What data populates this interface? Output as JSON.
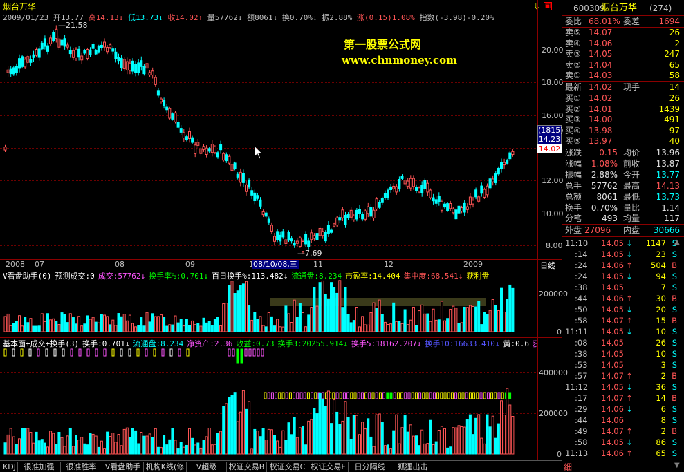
{
  "title": "烟台万华",
  "info_bar": {
    "date": "2009/01/23",
    "open": "开13.77",
    "high": "高14.13",
    "low": "低13.73",
    "close": "收14.02",
    "volume": "量57762",
    "amount": "额8061",
    "turnover": "换0.70%",
    "amplitude": "振2.88%",
    "change_label": "涨",
    "change": "(0.15)1.08%",
    "index": "指数(-3.98)-0.20%"
  },
  "watermark": {
    "line1": "第一股票公式网",
    "line2": "www.chnmoney.com"
  },
  "price_annotations": {
    "high_mark": "21.58",
    "low_mark": "7.69"
  },
  "price_axis": [
    "20.00",
    "18.00",
    "16.00",
    "14.00",
    "12.00",
    "10.00",
    "8.00"
  ],
  "crosshair_box": {
    "top": "(1815)",
    "value": "14.23"
  },
  "current_price_tag": "14.02",
  "date_axis": {
    "labels": [
      "2008",
      "07",
      "08",
      "09",
      "10",
      "11",
      "12",
      "2009"
    ],
    "cursor_date": "08/10/08,三",
    "period": "日线"
  },
  "ind1": {
    "header": [
      {
        "text": "V看盘助手(0)",
        "color": "#ffffff"
      },
      {
        "text": "预测成交:0",
        "color": "#ffffff"
      },
      {
        "text": "成交:57762↓",
        "color": "#ff55ff"
      },
      {
        "text": "换手率%:0.701↓",
        "color": "#00ff00"
      },
      {
        "text": "百日换手%:113.482↓",
        "color": "#ffffff"
      },
      {
        "text": "流通盘:8.234",
        "color": "#00ff00"
      },
      {
        "text": "市盈率:14.404",
        "color": "#ffff00"
      },
      {
        "text": "集中度:68.541↓",
        "color": "#ff5555"
      },
      {
        "text": "获利盘",
        "color": "#ffff00"
      }
    ],
    "axis": [
      "200000",
      "0"
    ]
  },
  "ind2": {
    "header": [
      {
        "text": "基本面+成交+换手(3)",
        "color": "#ffffff"
      },
      {
        "text": "换手:0.701↓",
        "color": "#ffffff"
      },
      {
        "text": "流通盘:8.234",
        "color": "#00ffff"
      },
      {
        "text": "净资产:2.36",
        "color": "#ff55ff"
      },
      {
        "text": "收益:0.73",
        "color": "#00ff00"
      },
      {
        "text": "换手3:20255.914↓",
        "color": "#00ff00"
      },
      {
        "text": "换手5:18162.207↓",
        "color": "#ff55ff"
      },
      {
        "text": "换手10:16633.410↓",
        "color": "#5555ff"
      },
      {
        "text": "黄:0.6",
        "color": "#ffffff"
      },
      {
        "text": "获",
        "color": "#ff55ff"
      }
    ],
    "axis": [
      "400000",
      "200000",
      "0"
    ]
  },
  "tabs": [
    "KDJ",
    "很准加强",
    "很准胜率",
    "V看盘助手",
    "机构K线(修",
    "V超级MACD",
    "权证交易B",
    "权证交易C",
    "权证交易F",
    "日分隔线",
    "狐狸出击"
  ],
  "quote": {
    "code": "600309",
    "name": "烟台万华",
    "count": "(274)",
    "weibi_label": "委比",
    "weibi": "68.01%",
    "weicha_label": "委差",
    "weicha": "1694",
    "sells": [
      {
        "label": "卖⑤",
        "price": "14.07",
        "vol": "26"
      },
      {
        "label": "卖④",
        "price": "14.06",
        "vol": "2"
      },
      {
        "label": "卖③",
        "price": "14.05",
        "vol": "247"
      },
      {
        "label": "卖②",
        "price": "14.04",
        "vol": "65"
      },
      {
        "label": "卖①",
        "price": "14.03",
        "vol": "58"
      }
    ],
    "latest_label": "最新",
    "latest": "14.02",
    "xianshou_label": "现手",
    "xianshou": "14",
    "buys": [
      {
        "label": "买①",
        "price": "14.02",
        "vol": "26"
      },
      {
        "label": "买②",
        "price": "14.01",
        "vol": "1439"
      },
      {
        "label": "买③",
        "price": "14.00",
        "vol": "491"
      },
      {
        "label": "买④",
        "price": "13.98",
        "vol": "97"
      },
      {
        "label": "买⑤",
        "price": "13.97",
        "vol": "40"
      }
    ],
    "stats": [
      {
        "l1": "涨跌",
        "v1": "0.15",
        "c1": "red",
        "l2": "均价",
        "v2": "13.96",
        "c2": "white"
      },
      {
        "l1": "涨幅",
        "v1": "1.08%",
        "c1": "red",
        "l2": "前收",
        "v2": "13.87",
        "c2": "white"
      },
      {
        "l1": "振幅",
        "v1": "2.88%",
        "c1": "white",
        "l2": "今开",
        "v2": "13.77",
        "c2": "cyan"
      },
      {
        "l1": "总手",
        "v1": "57762",
        "c1": "white",
        "l2": "最高",
        "v2": "14.13",
        "c2": "red"
      },
      {
        "l1": "总额",
        "v1": "8061",
        "c1": "white",
        "l2": "最低",
        "v2": "13.73",
        "c2": "cyan"
      },
      {
        "l1": "换手",
        "v1": "0.70%",
        "c1": "white",
        "l2": "量比",
        "v2": "1.14",
        "c2": "white"
      },
      {
        "l1": "分笔",
        "v1": "493",
        "c1": "white",
        "l2": "均量",
        "v2": "117",
        "c2": "white"
      }
    ],
    "waipan_label": "外盘",
    "waipan": "27096",
    "neipan_label": "内盘",
    "neipan": "30666"
  },
  "ticks": [
    {
      "time": "11:10",
      "price": "14.05",
      "arrow": "↓",
      "vol": "1147",
      "bs": "S"
    },
    {
      "time": ":14",
      "price": "14.05",
      "arrow": "↓",
      "vol": "23",
      "bs": "S"
    },
    {
      "time": ":24",
      "price": "14.06",
      "arrow": "↑",
      "vol": "504",
      "bs": "B"
    },
    {
      "time": ":24",
      "price": "14.05",
      "arrow": "↓",
      "vol": "94",
      "bs": "S"
    },
    {
      "time": ":38",
      "price": "14.05",
      "arrow": "",
      "vol": "7",
      "bs": "S"
    },
    {
      "time": ":44",
      "price": "14.06",
      "arrow": "↑",
      "vol": "30",
      "bs": "B"
    },
    {
      "time": ":50",
      "price": "14.05",
      "arrow": "↓",
      "vol": "20",
      "bs": "S"
    },
    {
      "time": ":58",
      "price": "14.07",
      "arrow": "↑",
      "vol": "15",
      "bs": "B"
    },
    {
      "time": "11:11",
      "price": "14.05",
      "arrow": "↓",
      "vol": "10",
      "bs": "S"
    },
    {
      "time": ":08",
      "price": "14.05",
      "arrow": "",
      "vol": "26",
      "bs": "S"
    },
    {
      "time": ":38",
      "price": "14.05",
      "arrow": "",
      "vol": "10",
      "bs": "S"
    },
    {
      "time": ":53",
      "price": "14.05",
      "arrow": "",
      "vol": "3",
      "bs": "S"
    },
    {
      "time": ":57",
      "price": "14.07",
      "arrow": "↑",
      "vol": "2",
      "bs": "B"
    },
    {
      "time": "11:12",
      "price": "14.05",
      "arrow": "↓",
      "vol": "36",
      "bs": "S"
    },
    {
      "time": ":17",
      "price": "14.07",
      "arrow": "↑",
      "vol": "14",
      "bs": "B"
    },
    {
      "time": ":29",
      "price": "14.06",
      "arrow": "↓",
      "vol": "6",
      "bs": "S"
    },
    {
      "time": ":44",
      "price": "14.06",
      "arrow": "",
      "vol": "8",
      "bs": "S"
    },
    {
      "time": ":49",
      "price": "14.07",
      "arrow": "↑",
      "vol": "2",
      "bs": "B"
    },
    {
      "time": ":58",
      "price": "14.05",
      "arrow": "↓",
      "vol": "86",
      "bs": "S"
    },
    {
      "time": "11:13",
      "price": "14.06",
      "arrow": "↑",
      "vol": "65",
      "bs": "S"
    }
  ],
  "bottom_right_label": "细"
}
